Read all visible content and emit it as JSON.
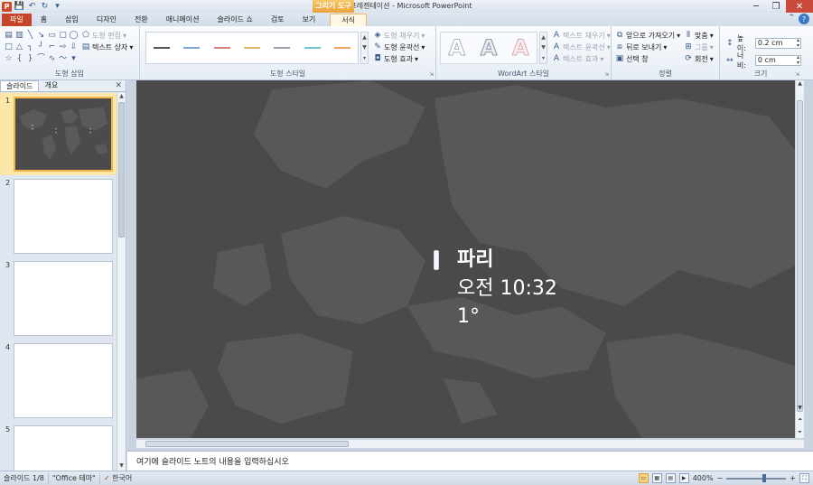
{
  "window": {
    "title": "새 프레젠테이션 - Microsoft PowerPoint",
    "contextual_tab": "그리기 도구",
    "controls": [
      "─",
      "❐",
      "✕"
    ]
  },
  "qat": {
    "app_letter": "P",
    "save": "💾",
    "undo": "↶",
    "redo": "↻",
    "more": "▾"
  },
  "tabs": [
    {
      "label": "파일"
    },
    {
      "label": "홈"
    },
    {
      "label": "삽입"
    },
    {
      "label": "디자인"
    },
    {
      "label": "전환"
    },
    {
      "label": "애니메이션"
    },
    {
      "label": "슬라이드 쇼"
    },
    {
      "label": "검토"
    },
    {
      "label": "보기"
    },
    {
      "label": "서식"
    }
  ],
  "ribbon": {
    "insert_shapes": {
      "label": "도형 삽입",
      "edit_shape": "도형 편집",
      "text_box": "텍스트 상자"
    },
    "shape_styles": {
      "label": "도형 스타일",
      "fill": "도형 채우기",
      "outline": "도형 윤곽선",
      "effects": "도형 효과",
      "line_colors": [
        "#555555",
        "#7aa6d6",
        "#d98080",
        "#e0b868",
        "#9aa0a8",
        "#74c2cc",
        "#f0a860"
      ]
    },
    "wordart_styles": {
      "label": "WordArt 스타일",
      "letter": "A",
      "text_fill": "텍스트 채우기",
      "text_outline": "텍스트 윤곽선",
      "text_effects": "텍스트 효과"
    },
    "arrange": {
      "label": "정렬",
      "bring_forward": "앞으로 가져오기",
      "send_backward": "뒤로 보내기",
      "selection_pane": "선택 창",
      "align": "맞춤",
      "group": "그룹",
      "rotate": "회전"
    },
    "size": {
      "label": "크기",
      "height_label": "높이:",
      "height_value": "0.2 cm",
      "width_label": "너비:",
      "width_value": "0 cm"
    }
  },
  "left_panel": {
    "tabs": [
      "슬라이드",
      "개요"
    ],
    "close": "✕",
    "slide_numbers": [
      "1",
      "2",
      "3",
      "4",
      "5"
    ]
  },
  "slide": {
    "city": "파리",
    "time": "오전 10:32",
    "temperature": "1°"
  },
  "notes": {
    "placeholder": "여기에 슬라이드 노트의 내용을 입력하십시오"
  },
  "status": {
    "slide_info": "슬라이드 1/8",
    "theme": "\"Office 테마\"",
    "language": "한국어",
    "zoom": "400%",
    "minus": "−",
    "plus": "+"
  }
}
